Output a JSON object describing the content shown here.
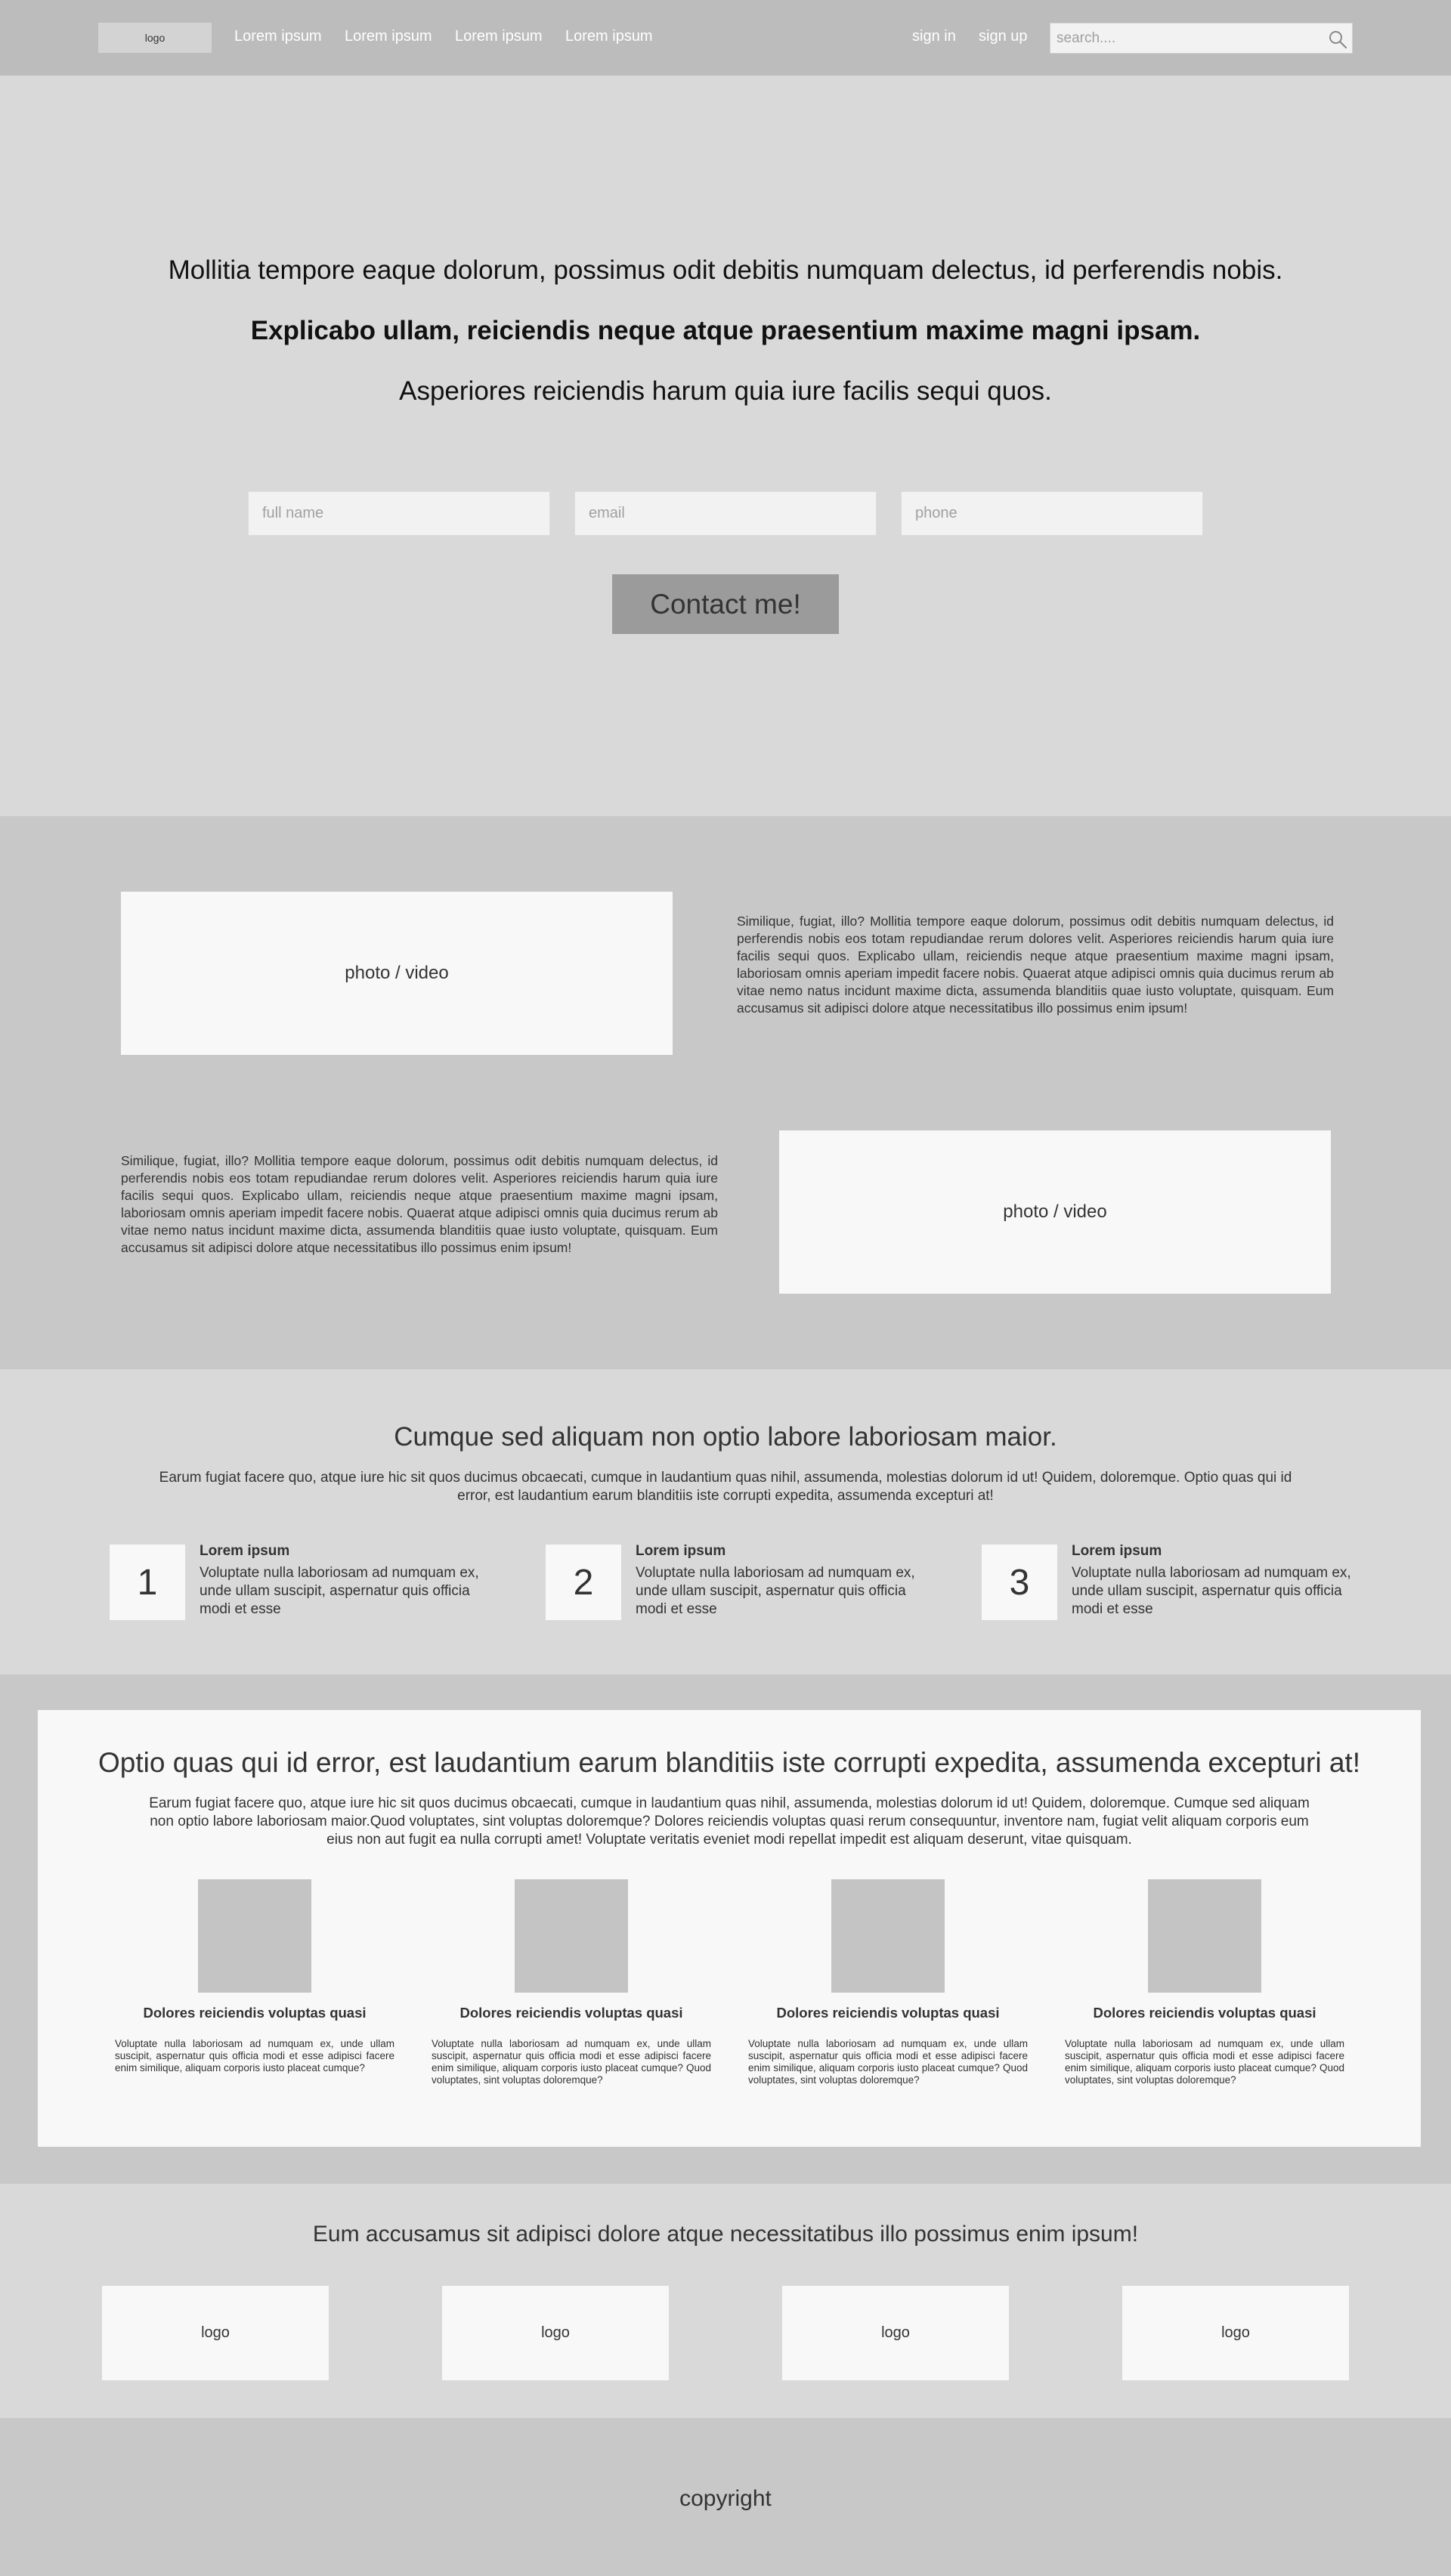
{
  "header": {
    "logo": "logo",
    "nav": [
      "Lorem ipsum",
      "Lorem ipsum",
      "Lorem ipsum",
      "Lorem ipsum"
    ],
    "sign_in": "sign in",
    "sign_up": "sign up",
    "search_placeholder": "search....",
    "search_icon": "search-icon"
  },
  "hero": {
    "line1": "Mollitia tempore eaque dolorum, possimus odit debitis numquam delectus, id perferendis nobis.",
    "line2": "Explicabo ullam, reiciendis neque atque praesentium maxime magni ipsam.",
    "line3": "Asperiores reiciendis harum quia iure facilis sequi quos.",
    "placeholders": {
      "full_name": "full name",
      "email": "email",
      "phone": "phone"
    },
    "button": "Contact me!"
  },
  "media": {
    "photo_label": "photo / video",
    "text": "Similique, fugiat, illo? Mollitia tempore eaque dolorum, possimus odit debitis numquam delectus, id perferendis nobis eos totam repudiandae rerum dolores velit. Asperiores reiciendis harum quia iure facilis sequi quos. Explicabo ullam, reiciendis neque atque praesentium maxime magni ipsam, laboriosam omnis aperiam impedit facere nobis. Quaerat atque adipisci omnis quia ducimus rerum ab vitae nemo natus incidunt maxime dicta, assumenda blanditiis quae iusto voluptate, quisquam. Eum accusamus sit adipisci dolore atque necessitatibus illo possimus enim ipsum!"
  },
  "steps": {
    "title": "Cumque sed aliquam non optio labore laboriosam maior.",
    "desc": "Earum fugiat facere quo, atque iure hic sit quos ducimus obcaecati, cumque in laudantium quas nihil, assumenda, molestias dolorum id ut! Quidem, doloremque. Optio quas qui id error, est laudantium earum blanditiis iste corrupti expedita, assumenda excepturi at!",
    "items": [
      {
        "num": "1",
        "title": "Lorem ipsum",
        "text": "Voluptate nulla laboriosam ad numquam ex, unde ullam suscipit, aspernatur quis officia modi et esse"
      },
      {
        "num": "2",
        "title": "Lorem ipsum",
        "text": "Voluptate nulla laboriosam ad numquam ex, unde ullam suscipit, aspernatur quis officia modi et esse"
      },
      {
        "num": "3",
        "title": "Lorem ipsum",
        "text": "Voluptate nulla laboriosam ad numquam ex, unde ullam suscipit, aspernatur quis officia modi et esse"
      }
    ]
  },
  "features": {
    "title": "Optio quas qui id error, est laudantium earum blanditiis iste corrupti expedita, assumenda excepturi at!",
    "desc": "Earum fugiat facere quo, atque iure hic sit quos ducimus obcaecati, cumque in laudantium quas nihil, assumenda, molestias dolorum id ut! Quidem, doloremque. Cumque sed aliquam non optio labore laboriosam maior.Quod voluptates, sint voluptas doloremque? Dolores reiciendis voluptas quasi rerum consequuntur, inventore nam, fugiat velit aliquam corporis eum eius non aut fugit ea nulla corrupti amet! Voluptate veritatis eveniet modi repellat impedit est aliquam deserunt, vitae quisquam.",
    "items": [
      {
        "title": "Dolores reiciendis voluptas quasi",
        "text": "Voluptate nulla laboriosam ad numquam ex, unde ullam suscipit, aspernatur quis officia modi et esse adipisci facere enim similique, aliquam corporis iusto placeat cumque?"
      },
      {
        "title": "Dolores reiciendis voluptas quasi",
        "text": "Voluptate nulla laboriosam ad numquam ex, unde ullam suscipit, aspernatur quis officia modi et esse adipisci facere enim similique, aliquam corporis iusto placeat cumque? Quod voluptates, sint voluptas doloremque?"
      },
      {
        "title": "Dolores reiciendis voluptas quasi",
        "text": "Voluptate nulla laboriosam ad numquam ex, unde ullam suscipit, aspernatur quis officia modi et esse adipisci facere enim similique, aliquam corporis iusto placeat cumque? Quod voluptates, sint voluptas doloremque?"
      },
      {
        "title": "Dolores reiciendis voluptas quasi",
        "text": "Voluptate nulla laboriosam ad numquam ex, unde ullam suscipit, aspernatur quis officia modi et esse adipisci facere enim similique, aliquam corporis iusto placeat cumque? Quod voluptates, sint voluptas doloremque?"
      }
    ]
  },
  "logos": {
    "title": "Eum accusamus sit adipisci dolore atque necessitatibus illo possimus enim ipsum!",
    "items": [
      "logo",
      "logo",
      "logo",
      "logo"
    ]
  },
  "footer": {
    "copyright": "copyright"
  },
  "colors": {
    "header_bg": "#bcbcbc",
    "section_light": "#d9d9d9",
    "section_dark": "#c8c8c8",
    "card_bg": "#f8f8f8",
    "button_bg": "#9b9b9b"
  }
}
